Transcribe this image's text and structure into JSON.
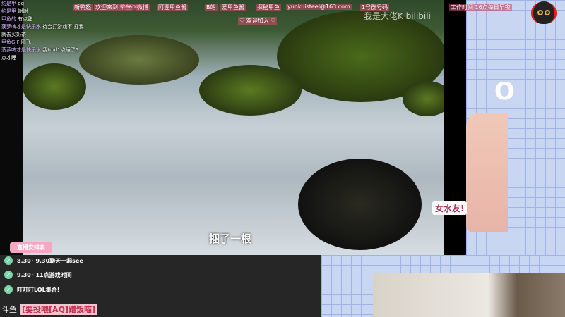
{
  "chat_messages": [
    {
      "user": "约是甲",
      "text": "gg"
    },
    {
      "user": "约是甲",
      "text": "谢谢"
    },
    {
      "user": "甲鱼的",
      "text": "有点甜"
    },
    {
      "user": "菠萝啤才是快乐水",
      "text": "待会打游戏不 打我"
    },
    {
      "user": "",
      "text": "就去买奶茶"
    },
    {
      "user": "甲鱼GIF",
      "text": "圈飞"
    },
    {
      "user": "菠萝啤才是快乐水",
      "text": "我tmd1点睡了5"
    },
    {
      "user": "",
      "text": "点才睡"
    }
  ],
  "danmu": [
    "新鸭怒",
    "欢迎来到 甲鱼",
    "steam",
    "微博",
    "阿狸甲鱼酱",
    "B站",
    "爱甲鱼酱",
    "探秘甲鱼",
    "yunkuisteel@163.com",
    "1号群号码",
    "工作时间 16点每日早夜",
    "♡ 欢迎加入 ♡"
  ],
  "watermark": "我是大佬K bilibili",
  "subtitle": "捆了一根",
  "nickname_tag": "女水友!",
  "schedule": {
    "title": "直播安排表",
    "items": [
      "8.30~9.30聊天一起see",
      "9.30~11点游戏时间",
      "叮叮叮LOL集合!"
    ]
  },
  "platform": "斗鱼",
  "room_name": "[要投喂[AQ]蹭饭喵]",
  "colors": {
    "accent": "#f3a7c0",
    "check": "#7bd6a8",
    "grid": "#c9d6f2"
  }
}
